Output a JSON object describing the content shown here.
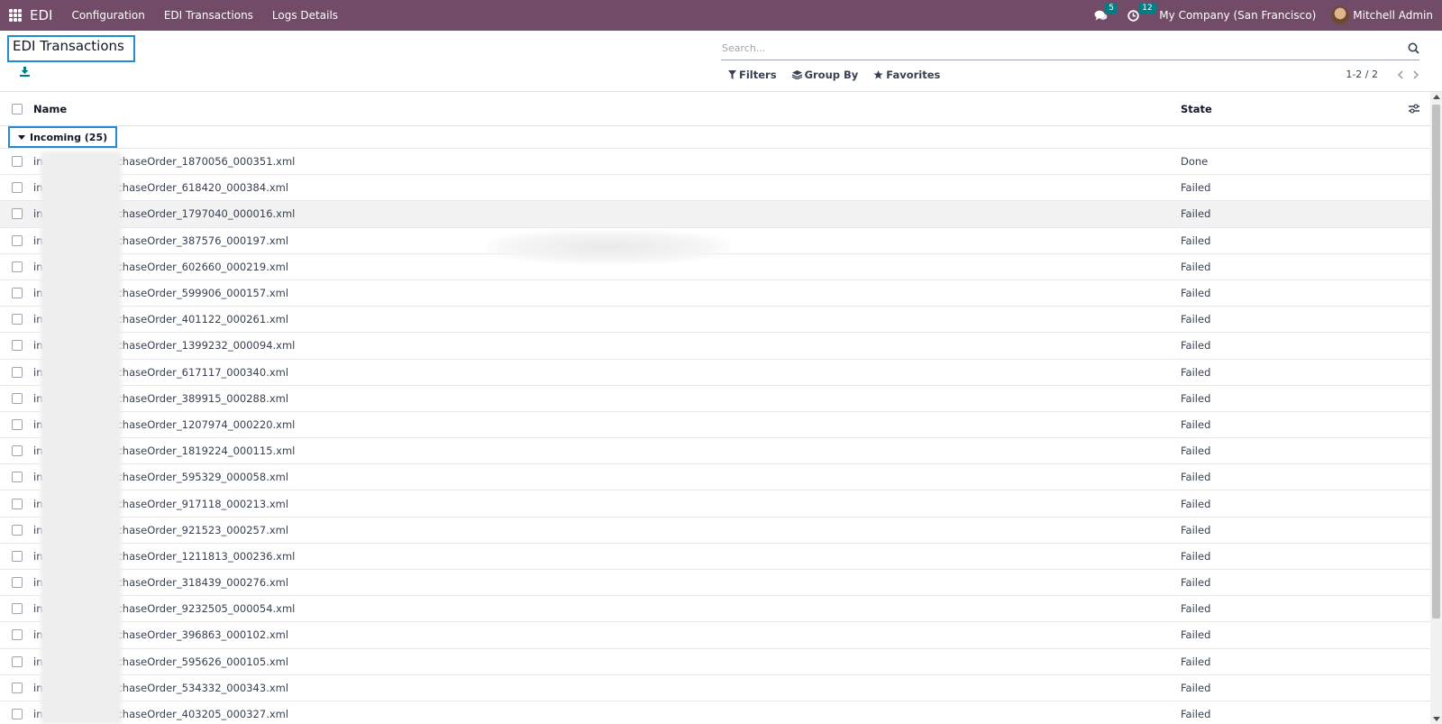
{
  "navbar": {
    "app_name": "EDI",
    "menu": [
      "Configuration",
      "EDI Transactions",
      "Logs Details"
    ],
    "messages_count": "5",
    "activities_count": "12",
    "company": "My Company (San Francisco)",
    "user": "Mitchell Admin"
  },
  "control": {
    "title": "EDI Transactions",
    "search_placeholder": "Search...",
    "filters_label": "Filters",
    "groupby_label": "Group By",
    "favorites_label": "Favorites",
    "pager": "1-2 / 2"
  },
  "list": {
    "columns": {
      "name": "Name",
      "state": "State"
    },
    "group": {
      "label": "Incoming (25)"
    },
    "rows": [
      {
        "name_prefix": "in",
        "name_suffix": "chaseOrder_1870056_000351.xml",
        "state": "Done"
      },
      {
        "name_prefix": "in",
        "name_suffix": "chaseOrder_618420_000384.xml",
        "state": "Failed"
      },
      {
        "name_prefix": "in",
        "name_suffix": "chaseOrder_1797040_000016.xml",
        "state": "Failed"
      },
      {
        "name_prefix": "in",
        "name_suffix": "chaseOrder_387576_000197.xml",
        "state": "Failed"
      },
      {
        "name_prefix": "in",
        "name_suffix": "chaseOrder_602660_000219.xml",
        "state": "Failed"
      },
      {
        "name_prefix": "in",
        "name_suffix": "chaseOrder_599906_000157.xml",
        "state": "Failed"
      },
      {
        "name_prefix": "in",
        "name_suffix": "chaseOrder_401122_000261.xml",
        "state": "Failed"
      },
      {
        "name_prefix": "in",
        "name_suffix": "chaseOrder_1399232_000094.xml",
        "state": "Failed"
      },
      {
        "name_prefix": "in",
        "name_suffix": "chaseOrder_617117_000340.xml",
        "state": "Failed"
      },
      {
        "name_prefix": "in",
        "name_suffix": "chaseOrder_389915_000288.xml",
        "state": "Failed"
      },
      {
        "name_prefix": "in",
        "name_suffix": "chaseOrder_1207974_000220.xml",
        "state": "Failed"
      },
      {
        "name_prefix": "in",
        "name_suffix": "chaseOrder_1819224_000115.xml",
        "state": "Failed"
      },
      {
        "name_prefix": "in",
        "name_suffix": "chaseOrder_595329_000058.xml",
        "state": "Failed"
      },
      {
        "name_prefix": "in",
        "name_suffix": "chaseOrder_917118_000213.xml",
        "state": "Failed"
      },
      {
        "name_prefix": "in",
        "name_suffix": "chaseOrder_921523_000257.xml",
        "state": "Failed"
      },
      {
        "name_prefix": "in",
        "name_suffix": "chaseOrder_1211813_000236.xml",
        "state": "Failed"
      },
      {
        "name_prefix": "in",
        "name_suffix": "chaseOrder_318439_000276.xml",
        "state": "Failed"
      },
      {
        "name_prefix": "in",
        "name_suffix": "chaseOrder_9232505_000054.xml",
        "state": "Failed"
      },
      {
        "name_prefix": "in",
        "name_suffix": "chaseOrder_396863_000102.xml",
        "state": "Failed"
      },
      {
        "name_prefix": "in",
        "name_suffix": "chaseOrder_595626_000105.xml",
        "state": "Failed"
      },
      {
        "name_prefix": "in",
        "name_suffix": "chaseOrder_534332_000343.xml",
        "state": "Failed"
      },
      {
        "name_prefix": "in",
        "name_suffix": "chaseOrder_403205_000327.xml",
        "state": "Failed"
      }
    ]
  },
  "colors": {
    "navbar": "#714b67",
    "badge": "#017e84",
    "focus": "#1f8bd8"
  },
  "icons": [
    "apps-grid-icon",
    "chat-icon",
    "clock-icon",
    "download-icon",
    "search-icon",
    "filter-icon",
    "layers-icon",
    "star-icon",
    "chevron-left-icon",
    "chevron-right-icon",
    "column-settings-icon",
    "caret-down-icon"
  ]
}
